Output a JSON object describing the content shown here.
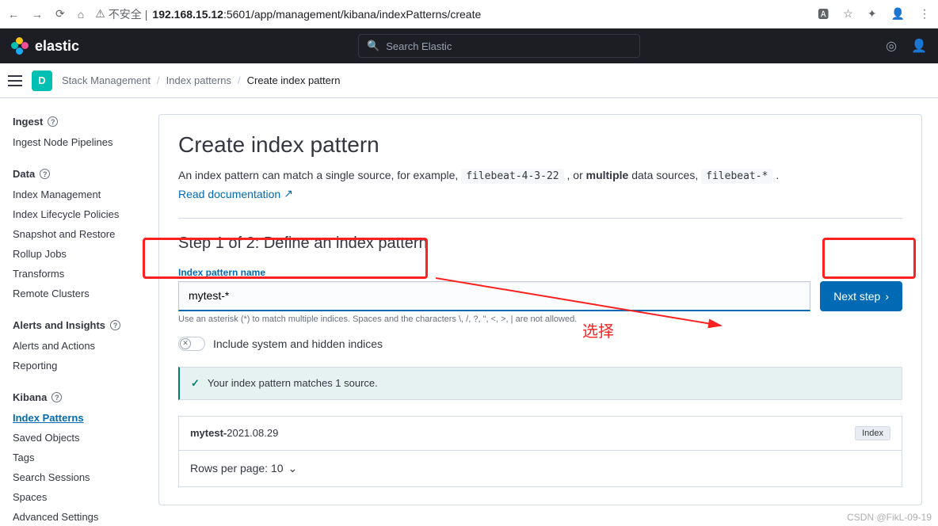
{
  "browser": {
    "insecure": "不安全",
    "url_prefix": "192.168.15.12",
    "url_port": ":5601/app/management/kibana/indexPatterns/create"
  },
  "header": {
    "brand": "elastic",
    "search_placeholder": "Search Elastic"
  },
  "space_letter": "D",
  "breadcrumb": {
    "a": "Stack Management",
    "b": "Index patterns",
    "c": "Create index pattern"
  },
  "sidebar": {
    "s1": {
      "title": "Ingest",
      "items": [
        "Ingest Node Pipelines"
      ]
    },
    "s2": {
      "title": "Data",
      "items": [
        "Index Management",
        "Index Lifecycle Policies",
        "Snapshot and Restore",
        "Rollup Jobs",
        "Transforms",
        "Remote Clusters"
      ]
    },
    "s3": {
      "title": "Alerts and Insights",
      "items": [
        "Alerts and Actions",
        "Reporting"
      ]
    },
    "s4": {
      "title": "Kibana",
      "items": [
        "Index Patterns",
        "Saved Objects",
        "Tags",
        "Search Sessions",
        "Spaces",
        "Advanced Settings"
      ]
    }
  },
  "main": {
    "title": "Create index pattern",
    "desc_a": "An index pattern can match a single source, for example,",
    "desc_code1": "filebeat-4-3-22",
    "desc_b": ", or",
    "desc_multiple": "multiple",
    "desc_c": "data sources,",
    "desc_code2": "filebeat-*",
    "desc_d": ".",
    "doclink": "Read documentation",
    "step_title": "Step 1 of 2: Define an index pattern",
    "field_label": "Index pattern name",
    "field_value": "mytest-*",
    "hint_a": "Use an asterisk (*) to match multiple indices. Spaces and the characters",
    "hint_chars": "\\, /, ?, \", <, >, |",
    "hint_b": "are not allowed.",
    "next": "Next step",
    "toggle_label": "Include system and hidden indices",
    "callout": "Your index pattern matches 1 source.",
    "result_prefix": "mytest-",
    "result_suffix": "2021.08.29",
    "badge": "Index",
    "rpp": "Rows per page: 10"
  },
  "annotation": {
    "label": "选择"
  },
  "watermark": "CSDN @FikL-09-19"
}
